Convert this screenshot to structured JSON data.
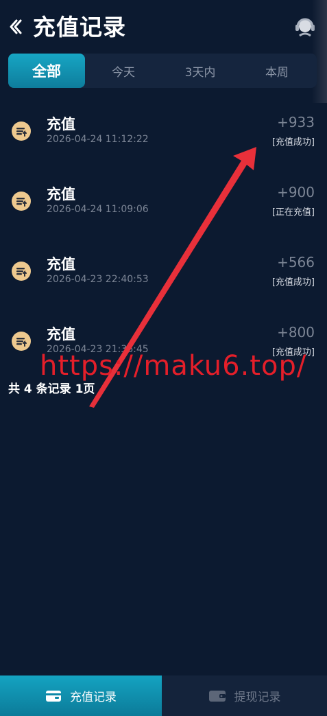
{
  "header": {
    "title": "充值记录"
  },
  "tabs": [
    {
      "label": "全部",
      "active": true
    },
    {
      "label": "今天",
      "active": false
    },
    {
      "label": "3天内",
      "active": false
    },
    {
      "label": "本周",
      "active": false
    }
  ],
  "records": [
    {
      "title": "充值",
      "time": "2026-04-24 11:12:22",
      "amount": "+933",
      "status": "[充值成功]"
    },
    {
      "title": "充值",
      "time": "2026-04-24 11:09:06",
      "amount": "+900",
      "status": "[正在充值]"
    },
    {
      "title": "充值",
      "time": "2026-04-23 22:40:53",
      "amount": "+566",
      "status": "[充值成功]"
    },
    {
      "title": "充值",
      "time": "2026-04-23 21:36:45",
      "amount": "+800",
      "status": "[充值成功]"
    }
  ],
  "summary": "共 4 条记录 1页",
  "watermark": "https://maku6.top/",
  "bottom_nav": [
    {
      "label": "充值记录",
      "icon": "wallet-card-icon",
      "active": true
    },
    {
      "label": "提现记录",
      "icon": "wallet-icon",
      "active": false
    }
  ],
  "colors": {
    "accent": "#0e8fb0",
    "background": "#0c1a30",
    "muted": "#7d8696",
    "icon": "#eec98f",
    "watermark": "#e41f2a"
  }
}
